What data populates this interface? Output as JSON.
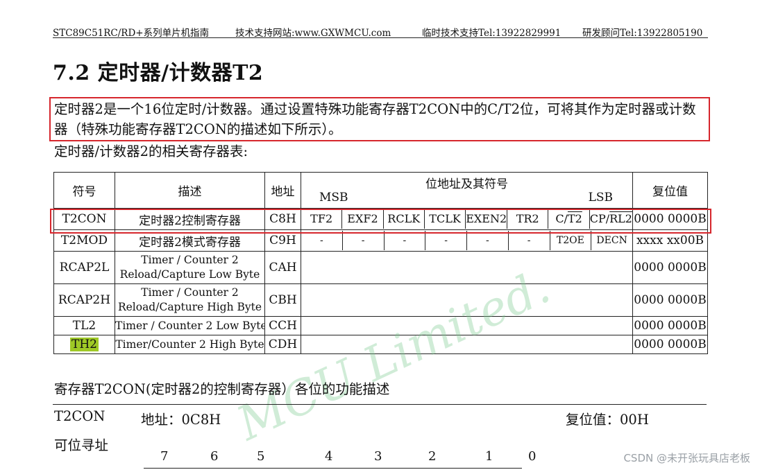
{
  "header": {
    "doc": "STC89C51RC/RD+系列单片机指南",
    "site": "技术支持网站:www.GXWMCU.com",
    "tel1": "临时技术支持Tel:13922829991",
    "tel2": "研发顾问Tel:13922805190"
  },
  "section_title": "7.2  定时器/计数器T2",
  "intro_text": "定时器2是一个16位定时/计数器。通过设置特殊功能寄存器T2CON中的C/T2位，可将其作为定时器或计数器（特殊功能寄存器T2CON的描述如下所示）。",
  "table_caption": "定时器/计数器2的相关寄存器表:",
  "table": {
    "headers": {
      "symbol": "符号",
      "desc": "描述",
      "addr": "地址",
      "bits": "位地址及其符号",
      "msb": "MSB",
      "lsb": "LSB",
      "reset": "复位值"
    },
    "rows": [
      {
        "symbol": "T2CON",
        "desc": "定时器2控制寄存器",
        "addr": "C8H",
        "reset": "0000 0000B",
        "bits": [
          "TF2",
          "EXF2",
          "RCLK",
          "TCLK",
          "EXEN2",
          "TR2",
          "C/",
          "T2",
          "CP/",
          "RL2"
        ]
      },
      {
        "symbol": "T2MOD",
        "desc": "定时器2模式寄存器",
        "addr": "C9H",
        "reset": "xxxx xx00B",
        "bits": [
          "-",
          "-",
          "-",
          "-",
          "-",
          "-",
          "T2OE",
          "DECN"
        ]
      },
      {
        "symbol": "RCAP2L",
        "desc1": "Timer / Counter 2",
        "desc2": "Reload/Capture Low Byte",
        "addr": "CAH",
        "reset": "0000 0000B"
      },
      {
        "symbol": "RCAP2H",
        "desc1": "Timer / Counter 2",
        "desc2": "Reload/Capture High Byte",
        "addr": "CBH",
        "reset": "0000 0000B"
      },
      {
        "symbol": "TL2",
        "desc": "Timer / Counter 2 Low Byte",
        "addr": "CCH",
        "reset": "0000 0000B"
      },
      {
        "symbol": "TH2",
        "desc": "Timer/Counter 2 High Byte",
        "addr": "CDH",
        "reset": "0000 0000B"
      }
    ]
  },
  "section2_title": "寄存器T2CON(定时器2的控制寄存器）各位的功能描述",
  "reg_line": {
    "name": "T2CON",
    "addr": "地址：0C8H",
    "reset": "复位值：00H"
  },
  "bit_addressable": "可位寻址",
  "bit_numbers": [
    "7",
    "6",
    "5",
    "4",
    "3",
    "2",
    "1",
    "0"
  ],
  "watermark": "MCU Limited.",
  "csdn_tag": "CSDN @未开张玩具店老板",
  "colors": {
    "highlight_box": "#d6262c",
    "th2_highlight": "#9fc926",
    "watermark": "#78c88c"
  }
}
